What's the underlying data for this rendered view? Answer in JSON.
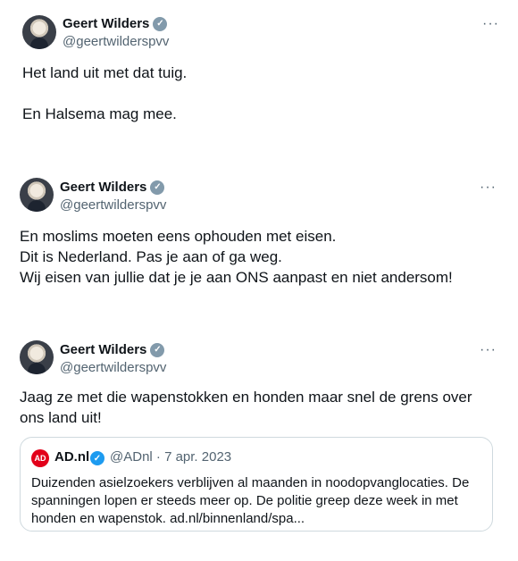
{
  "tweets": [
    {
      "name": "Geert Wilders",
      "handle": "@geertwilderspvv",
      "more": "···",
      "text": "Het land uit met dat tuig.\n\nEn Halsema mag mee."
    },
    {
      "name": "Geert Wilders",
      "handle": "@geertwilderspvv",
      "more": "···",
      "text": "En moslims moeten eens ophouden met eisen.\nDit is Nederland. Pas je aan of ga weg.\nWij eisen van jullie dat je je aan ONS aanpast en niet andersom!"
    },
    {
      "name": "Geert Wilders",
      "handle": "@geertwilderspvv",
      "more": "···",
      "text": "Jaag ze met die wapenstokken en honden maar snel de grens over ons land uit!"
    }
  ],
  "quote": {
    "logo": "AD",
    "name": "AD.nl",
    "meta": "@ADnl · 7 apr. 2023",
    "text": "Duizenden asielzoekers verblijven al maanden in noodopvanglocaties. De spanningen lopen er steeds meer op. De politie greep deze week in met honden en wapenstok. ad.nl/binnenland/spa..."
  },
  "icons": {
    "verified_gray": "verified-gray-icon",
    "verified_blue": "verified-blue-icon",
    "more": "more-dots-icon"
  },
  "colors": {
    "verified_gray": "#829aab",
    "verified_blue": "#1d9bf0",
    "ad_red": "#e2001a",
    "secondary_text": "#536471",
    "border": "#cfd9de"
  }
}
